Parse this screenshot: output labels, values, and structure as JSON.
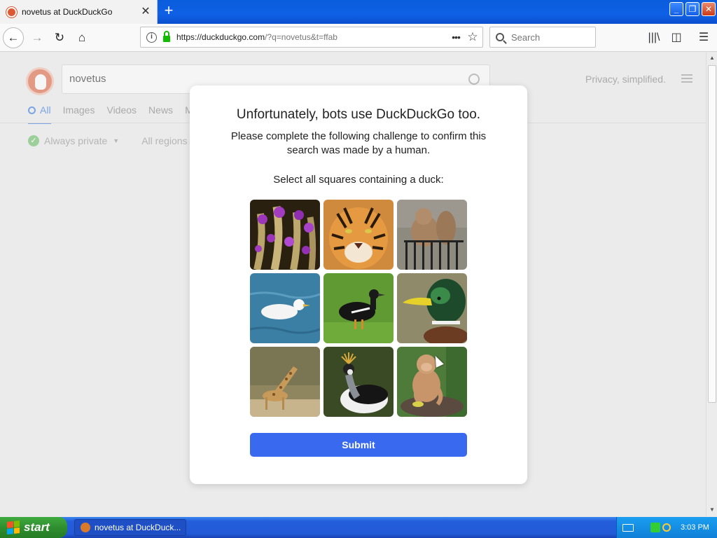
{
  "browser": {
    "tab_title": "novetus at DuckDuckGo",
    "new_tab_icon": "plus-icon",
    "url_host": "https://duckduckgo.com",
    "url_path": "/?q=novetus&t=ffab",
    "search_placeholder": "Search"
  },
  "page": {
    "search_value": "novetus",
    "privacy_text": "Privacy, simplified.",
    "tabs": [
      "All",
      "Images",
      "Videos",
      "News",
      "M"
    ],
    "filters": {
      "private": "Always private",
      "regions": "All regions"
    }
  },
  "challenge": {
    "heading": "Unfortunately, bots use DuckDuckGo too.",
    "subheading": "Please complete the following challenge to confirm this search was made by a human.",
    "instruction": "Select all squares containing a duck:",
    "tiles": [
      {
        "subject": "purple-flowers"
      },
      {
        "subject": "tiger"
      },
      {
        "subject": "squirrel"
      },
      {
        "subject": "white-duck"
      },
      {
        "subject": "black-duck"
      },
      {
        "subject": "mallard-duck"
      },
      {
        "subject": "giraffe"
      },
      {
        "subject": "crowned-crane"
      },
      {
        "subject": "monkey"
      }
    ],
    "submit_label": "Submit"
  },
  "taskbar": {
    "start_label": "start",
    "task_label": "novetus at DuckDuck...",
    "clock": "3:03 PM"
  },
  "colors": {
    "submit_blue": "#3969ef",
    "xp_blue": "#245edb",
    "ddg_orange": "#de5833"
  }
}
